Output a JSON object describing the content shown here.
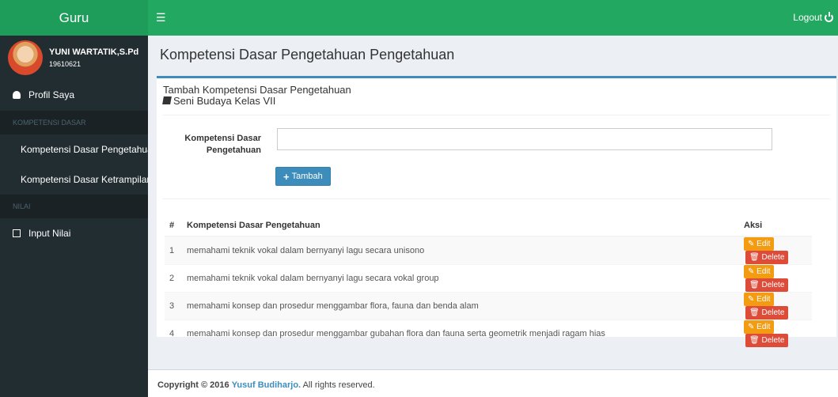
{
  "app": {
    "logo": "Guru",
    "logout_label": "Logout"
  },
  "user": {
    "name": "YUNI WARTATIK,S.Pd",
    "id": "19610621"
  },
  "sidebar": {
    "profile_label": "Profil Saya",
    "section_kd": "KOMPETENSI DASAR",
    "kd_pengetahuan": "Kompetensi Dasar Pengetahuan",
    "kd_ketrampilan": "Kompetensi Dasar Ketrampilan",
    "section_nilai": "NILAI",
    "input_nilai": "Input Nilai"
  },
  "page": {
    "title": "Kompetensi Dasar Pengetahuan Pengetahuan",
    "box_title": "Tambah Kompetensi Dasar Pengetahuan",
    "subject": "Seni Budaya Kelas VII"
  },
  "form": {
    "label_line1": "Kompetensi Dasar",
    "label_line2": "Pengetahuan",
    "input_value": "",
    "add_button": "Tambah"
  },
  "table": {
    "headers": {
      "num": "#",
      "kd": "Kompetensi Dasar Pengetahuan",
      "aksi": "Aksi"
    },
    "edit_label": "Edit",
    "delete_label": "Delete",
    "rows": [
      {
        "num": "1",
        "text": "memahami teknik vokal dalam bernyanyi lagu secara unisono"
      },
      {
        "num": "2",
        "text": "memahami teknik vokal dalam bernyanyi lagu secara vokal group"
      },
      {
        "num": "3",
        "text": "memahami konsep dan prosedur menggambar flora, fauna dan benda alam"
      },
      {
        "num": "4",
        "text": "memahami konsep dan prosedur menggambar gubahan flora dan fauna serta geometrik menjadi ragam hias"
      }
    ]
  },
  "footer": {
    "prefix": "Copyright © 2016",
    "author": "Yusuf Budiharjo.",
    "suffix": "All rights reserved."
  },
  "colors": {
    "topbar": "#22a860",
    "sidebar": "#222d32",
    "primary": "#3c8dbc",
    "edit": "#f39c12",
    "delete": "#dd4b39"
  }
}
